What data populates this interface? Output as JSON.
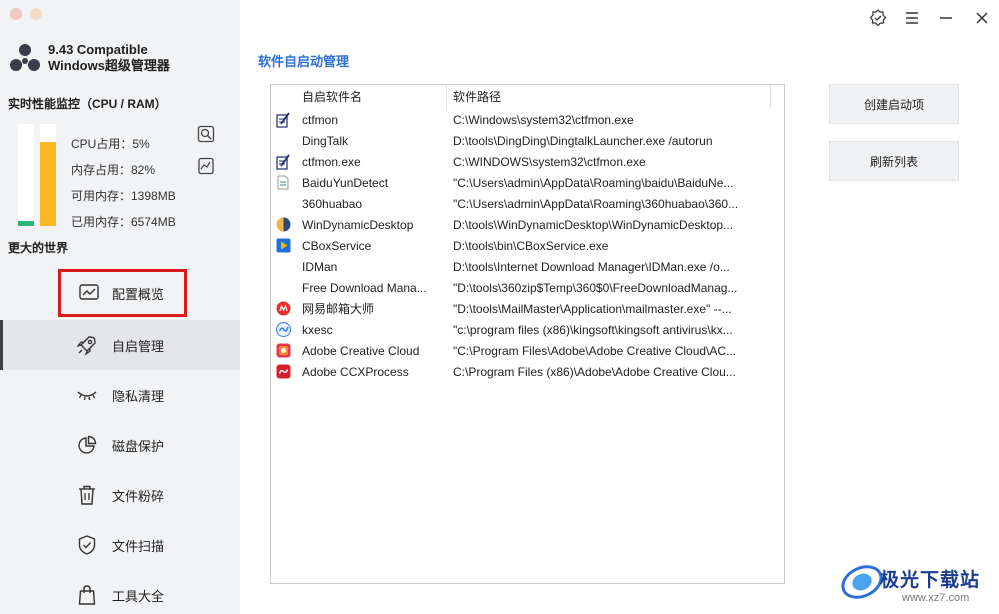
{
  "brand": {
    "line1": "9.43 Compatible",
    "line2": "Windows超级管理器"
  },
  "monitor": {
    "title": "实时性能监控（CPU / RAM）",
    "cpu_label": "CPU占用：5%",
    "mem_label": "内存占用：82%",
    "free_label": "可用内存：1398MB",
    "used_label": "已用内存：6574MB",
    "cpu_percent": 5,
    "mem_percent": 82,
    "cpu_color": "#2bb673",
    "mem_color": "#fdb827"
  },
  "world_label": "更大的世界",
  "nav": {
    "overview": "配置概览",
    "startup": "自启管理",
    "privacy": "隐私清理",
    "disk": "磁盘保护",
    "shred": "文件粉碎",
    "scan": "文件扫描",
    "tools": "工具大全"
  },
  "main": {
    "title": "软件自启动管理",
    "col_name": "自启软件名",
    "col_path": "软件路径",
    "rows": [
      {
        "name": "ctfmon",
        "path": "C:\\Windows\\system32\\ctfmon.exe",
        "icon": "notepad-icon"
      },
      {
        "name": "DingTalk",
        "path": "D:\\tools\\DingDing\\DingtalkLauncher.exe /autorun",
        "icon": "blank"
      },
      {
        "name": "ctfmon.exe",
        "path": "C:\\WINDOWS\\system32\\ctfmon.exe",
        "icon": "notepad-icon"
      },
      {
        "name": "BaiduYunDetect",
        "path": "\"C:\\Users\\admin\\AppData\\Roaming\\baidu\\BaiduNe...",
        "icon": "file-icon"
      },
      {
        "name": "360huabao",
        "path": "\"C:\\Users\\admin\\AppData\\Roaming\\360huabao\\360...",
        "icon": "blank"
      },
      {
        "name": "WinDynamicDesktop",
        "path": "D:\\tools\\WinDynamicDesktop\\WinDynamicDesktop...",
        "icon": "windynamic-icon"
      },
      {
        "name": "CBoxService",
        "path": "D:\\tools\\bin\\CBoxService.exe",
        "icon": "cbox-icon"
      },
      {
        "name": "IDMan",
        "path": "D:\\tools\\Internet Download Manager\\IDMan.exe /o...",
        "icon": "blank"
      },
      {
        "name": "Free Download Mana...",
        "path": "\"D:\\tools\\360zip$Temp\\360$0\\FreeDownloadManag...",
        "icon": "blank"
      },
      {
        "name": "网易邮箱大师",
        "path": "\"D:\\tools\\MailMaster\\Application\\mailmaster.exe\" --...",
        "icon": "mailmaster-icon"
      },
      {
        "name": "kxesc",
        "path": "\"c:\\program files (x86)\\kingsoft\\kingsoft antivirus\\kx...",
        "icon": "kingsoft-icon"
      },
      {
        "name": "Adobe Creative Cloud",
        "path": "\"C:\\Program Files\\Adobe\\Adobe Creative Cloud\\AC...",
        "icon": "adobe-cc-icon"
      },
      {
        "name": "Adobe CCXProcess",
        "path": "C:\\Program Files (x86)\\Adobe\\Adobe Creative Clou...",
        "icon": "adobe-ccx-icon"
      }
    ]
  },
  "buttons": {
    "create": "创建启动项",
    "refresh": "刷新列表"
  },
  "watermark": {
    "text": "极光下载站",
    "url": "www.xz7.com"
  }
}
